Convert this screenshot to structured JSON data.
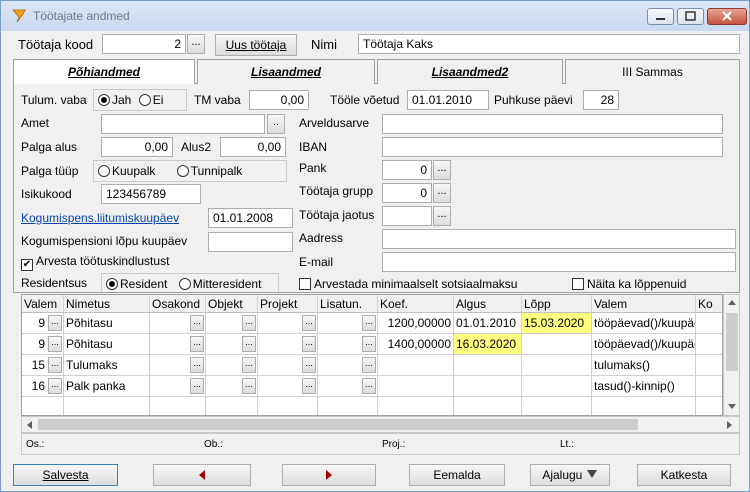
{
  "window": {
    "title": "Töötajate andmed"
  },
  "header": {
    "employee_code_label": "Töötaja kood",
    "employee_code_value": "2",
    "new_employee_label": "Uus töötaja",
    "name_label": "Nimi",
    "name_value": "Töötaja Kaks"
  },
  "tabs": [
    {
      "label": "Põhiandmed"
    },
    {
      "label": "Lisaandmed"
    },
    {
      "label": "Lisaandmed2"
    },
    {
      "label": "III Sammas"
    }
  ],
  "form": {
    "tulum_vaba_label": "Tulum. vaba",
    "yes_label": "Jah",
    "no_label": "Ei",
    "tm_vaba_label": "TM vaba",
    "tm_vaba_value": "0,00",
    "toole_label": "Tööle võetud",
    "toole_value": "01.01.2010",
    "puhkuse_label": "Puhkuse päevi",
    "puhkuse_value": "28",
    "amet_label": "Amet",
    "amet_value": "",
    "arveldusarve_label": "Arveldusarve",
    "arveldusarve_value": "",
    "palga_alus_label": "Palga alus",
    "palga_alus_value": "0,00",
    "alus2_label": "Alus2",
    "alus2_value": "0,00",
    "iban_label": "IBAN",
    "iban_value": "",
    "palga_tyyp_label": "Palga tüüp",
    "kuupalk_label": "Kuupalk",
    "tunnipalk_label": "Tunnipalk",
    "pank_label": "Pank",
    "pank_value": "0",
    "isikukood_label": "Isikukood",
    "isikukood_value": "123456789",
    "grupp_label": "Töötaja grupp",
    "grupp_value": "0",
    "kogumis_link": "Kogumispens.liitumiskuupäev",
    "kogumis_value": "01.01.2008",
    "jaotus_label": "Töötaja jaotus",
    "jaotus_value": "",
    "kogumis_lopp_label": "Kogumispensioni lõpu kuupäev",
    "kogumis_lopp_value": "",
    "aadress_label": "Aadress",
    "aadress_value": "",
    "kindlustus_label": "Arvesta töötuskindlustust",
    "email_label": "E-mail",
    "email_value": "",
    "residentsus_label": "Residentsus",
    "resident_label": "Resident",
    "mitteresident_label": "Mitteresident",
    "min_sots_label": "Arvestada minimaalselt sotsiaalmaksu",
    "naita_label": "Näita ka lõppenuid"
  },
  "grid": {
    "headers": [
      "Valem",
      "Nimetus",
      "Osakond",
      "Objekt",
      "Projekt",
      "Lisatun.",
      "Koef.",
      "Algus",
      "Lõpp",
      "Valem",
      "Ko"
    ],
    "rows": [
      {
        "valem": "9",
        "nimetus": "Põhitasu",
        "koef": "1200,00000",
        "algus": "01.01.2010",
        "lopp": "15.03.2020",
        "formula": "tööpäevad()/kuupäevad()"
      },
      {
        "valem": "9",
        "nimetus": "Põhitasu",
        "koef": "1400,00000",
        "algus": "16.03.2020",
        "lopp": "",
        "formula": "tööpäevad()/kuupäevad()"
      },
      {
        "valem": "15",
        "nimetus": "Tulumaks",
        "koef": "",
        "algus": "",
        "lopp": "",
        "formula": "tulumaks()"
      },
      {
        "valem": "16",
        "nimetus": "Palk panka",
        "koef": "",
        "algus": "",
        "lopp": "",
        "formula": "tasud()-kinnip()"
      }
    ]
  },
  "footer_info": {
    "os": "Os.:",
    "ob": "Ob.:",
    "proj": "Proj.:",
    "lt": "Lt.:"
  },
  "buttons": {
    "save": "Salvesta",
    "remove": "Eemalda",
    "history": "Ajalugu",
    "cancel": "Katkesta"
  }
}
